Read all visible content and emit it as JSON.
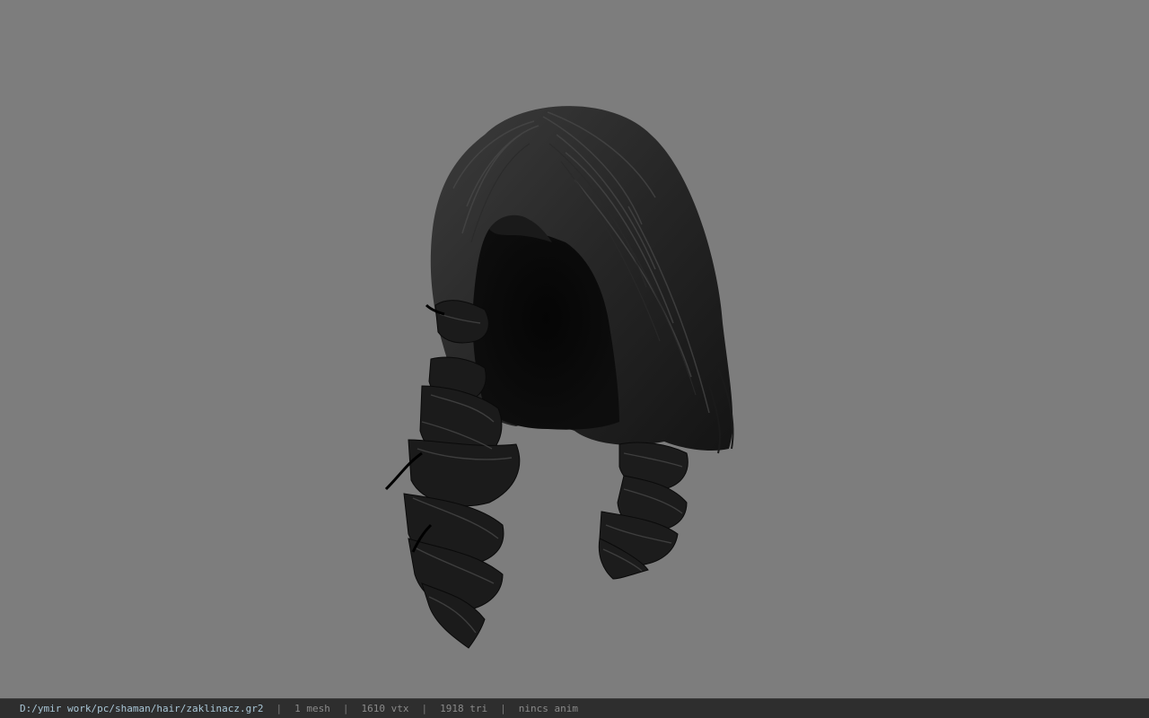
{
  "viewport": {
    "background": "#7d7d7d",
    "model": "hair-mesh",
    "hair_color": "#1c1c1c"
  },
  "statusbar": {
    "file_path": "D:/ymir work/pc/shaman/hair/zaklinacz.gr2",
    "separator": "|",
    "mesh_count": "1 mesh",
    "vertex_count": "1610 vtx",
    "triangle_count": "1918 tri",
    "anim_status": "nincs anim"
  }
}
